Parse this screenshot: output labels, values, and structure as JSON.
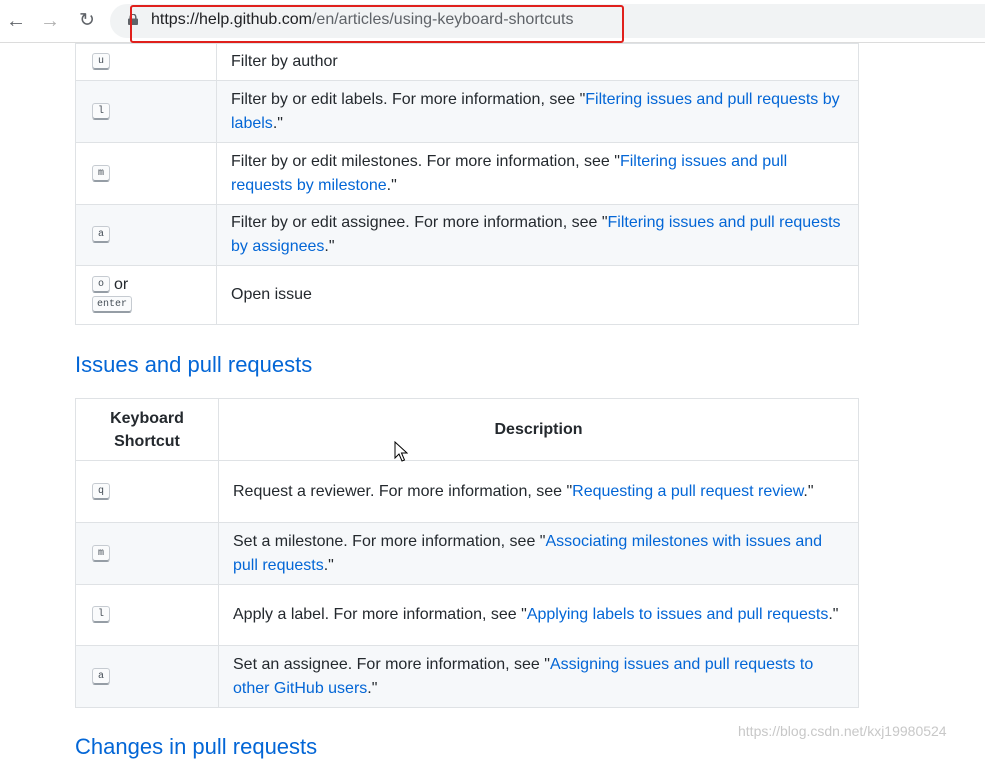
{
  "browser": {
    "url_host": "https://help.github.com",
    "url_path": "/en/articles/using-keyboard-shortcuts",
    "icons": {
      "back": "arrow-left-icon",
      "forward": "arrow-right-icon",
      "reload": "reload-icon",
      "lock": "lock-icon"
    }
  },
  "filter_table": {
    "rows": [
      {
        "key": "u",
        "text": "Filter by author",
        "link": "",
        "tail": ""
      },
      {
        "key": "l",
        "text": "Filter by or edit labels. For more information, see \"",
        "link": "Filtering issues and pull requests by labels",
        "tail": ".\""
      },
      {
        "key": "m",
        "text": "Filter by or edit milestones. For more information, see \"",
        "link": "Filtering issues and pull requests by milestone",
        "tail": ".\""
      },
      {
        "key": "a",
        "text": "Filter by or edit assignee. For more information, see \"",
        "link": "Filtering issues and pull requests by assignees",
        "tail": ".\""
      },
      {
        "key": "o",
        "or": "or",
        "key2": "enter",
        "text": "Open issue",
        "link": "",
        "tail": ""
      }
    ]
  },
  "issues_section": {
    "heading": "Issues and pull requests",
    "headers": {
      "shortcut": "Keyboard Shortcut",
      "description": "Description"
    },
    "rows": [
      {
        "key": "q",
        "text": "Request a reviewer. For more information, see \"",
        "link": "Requesting a pull request review",
        "tail": ".\""
      },
      {
        "key": "m",
        "text": "Set a milestone. For more information, see \"",
        "link": "Associating milestones with issues and pull requests",
        "tail": ".\""
      },
      {
        "key": "l",
        "text": "Apply a label. For more information, see \"",
        "link": "Applying labels to issues and pull requests",
        "tail": ".\""
      },
      {
        "key": "a",
        "text": "Set an assignee. For more information, see \"",
        "link": "Assigning issues and pull requests to other GitHub users",
        "tail": ".\""
      }
    ]
  },
  "next_heading": "Changes in pull requests",
  "watermark": "https://blog.csdn.net/kxj19980524"
}
